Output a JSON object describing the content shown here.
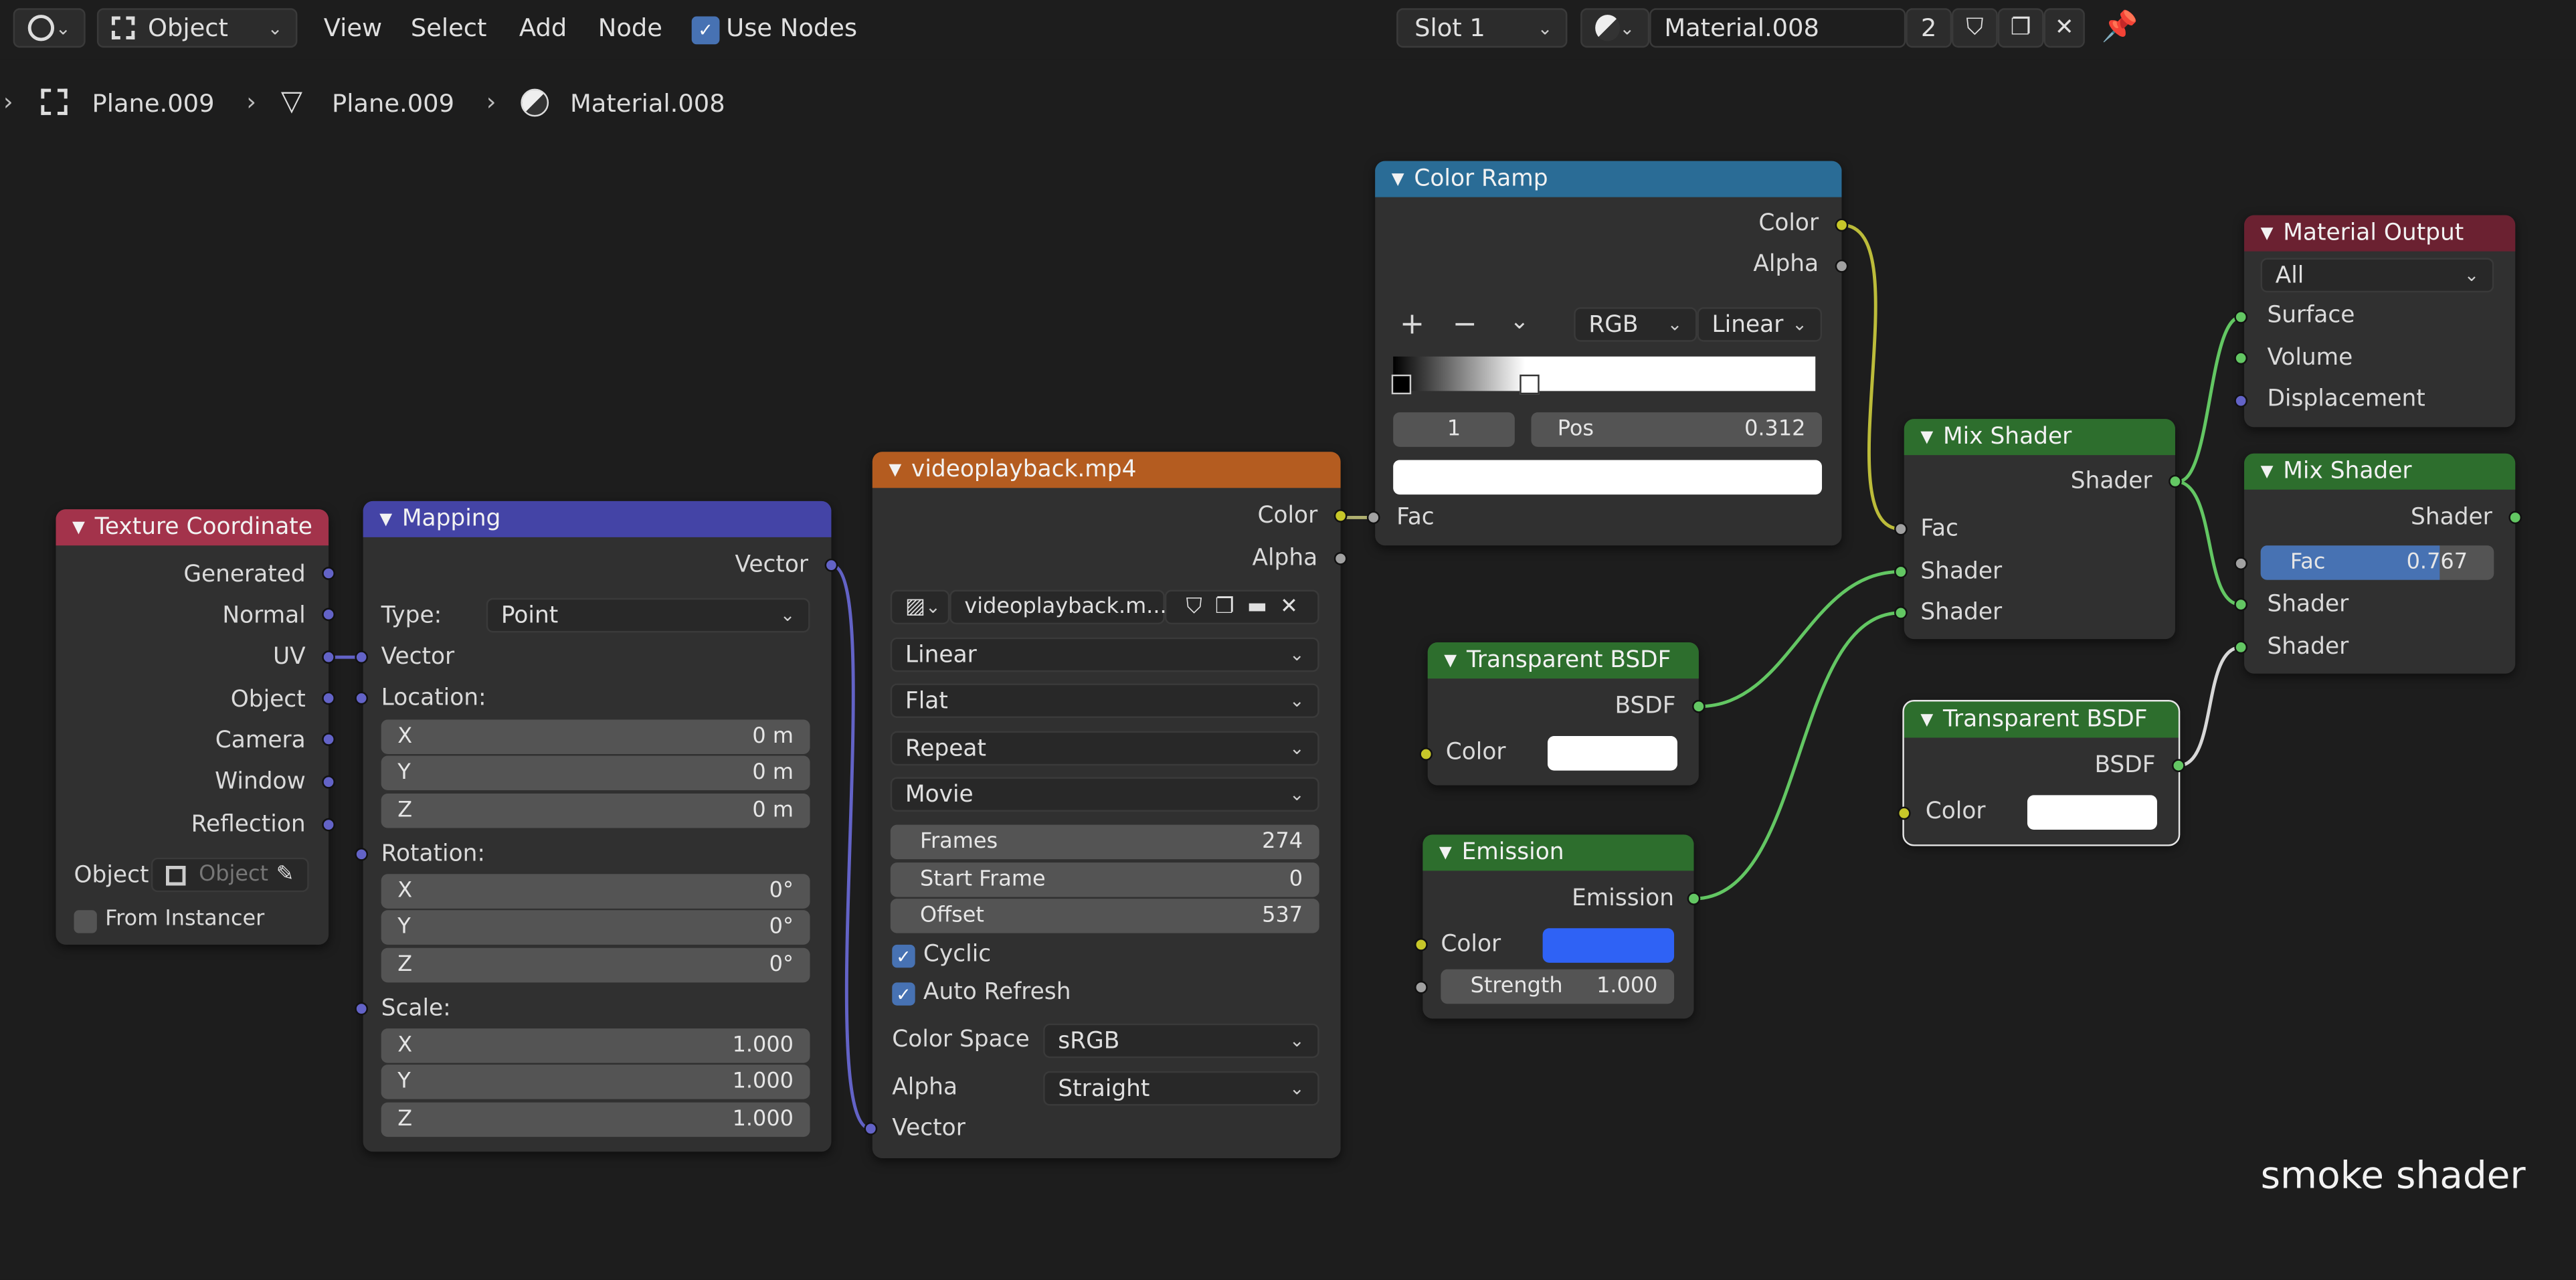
{
  "header": {
    "mode": "Object",
    "menus": [
      "View",
      "Select",
      "Add",
      "Node"
    ],
    "use_nodes_label": "Use Nodes",
    "slot": "Slot 1",
    "material_name": "Material.008",
    "user_count": "2"
  },
  "breadcrumb": {
    "items": [
      "Plane.009",
      "Plane.009",
      "Material.008"
    ]
  },
  "nodes": {
    "texcoord": {
      "title": "Texture Coordinate",
      "outputs": [
        "Generated",
        "Normal",
        "UV",
        "Object",
        "Camera",
        "Window",
        "Reflection"
      ],
      "object_label": "Object:",
      "object_placeholder": "Object",
      "from_instancer": "From Instancer"
    },
    "mapping": {
      "title": "Mapping",
      "output": "Vector",
      "type_label": "Type:",
      "type_value": "Point",
      "vector_label": "Vector",
      "location_label": "Location:",
      "location": [
        {
          "axis": "X",
          "value": "0 m"
        },
        {
          "axis": "Y",
          "value": "0 m"
        },
        {
          "axis": "Z",
          "value": "0 m"
        }
      ],
      "rotation_label": "Rotation:",
      "rotation": [
        {
          "axis": "X",
          "value": "0°"
        },
        {
          "axis": "Y",
          "value": "0°"
        },
        {
          "axis": "Z",
          "value": "0°"
        }
      ],
      "scale_label": "Scale:",
      "scale": [
        {
          "axis": "X",
          "value": "1.000"
        },
        {
          "axis": "Y",
          "value": "1.000"
        },
        {
          "axis": "Z",
          "value": "1.000"
        }
      ]
    },
    "video": {
      "title": "videoplayback.mp4",
      "out_color": "Color",
      "out_alpha": "Alpha",
      "image_name": "videoplayback.m...",
      "interpolation": "Linear",
      "projection": "Flat",
      "extension": "Repeat",
      "source": "Movie",
      "frames_label": "Frames",
      "frames": "274",
      "start_label": "Start Frame",
      "start": "0",
      "offset_label": "Offset",
      "offset": "537",
      "cyclic": "Cyclic",
      "auto_refresh": "Auto Refresh",
      "colorspace_label": "Color Space",
      "colorspace": "sRGB",
      "alpha_label": "Alpha",
      "alpha": "Straight",
      "in_vector": "Vector"
    },
    "colorramp": {
      "title": "Color Ramp",
      "out_color": "Color",
      "out_alpha": "Alpha",
      "mode": "RGB",
      "interp": "Linear",
      "index": "1",
      "pos_label": "Pos",
      "pos": "0.312",
      "in_fac": "Fac"
    },
    "transparent1": {
      "title": "Transparent BSDF",
      "out": "BSDF",
      "in_color": "Color"
    },
    "emission": {
      "title": "Emission",
      "out": "Emission",
      "in_color": "Color",
      "strength_label": "Strength",
      "strength": "1.000",
      "color": "#2f62f5"
    },
    "mix1": {
      "title": "Mix Shader",
      "out": "Shader",
      "in_fac": "Fac",
      "in_shader1": "Shader",
      "in_shader2": "Shader"
    },
    "transparent2": {
      "title": "Transparent BSDF",
      "out": "BSDF",
      "in_color": "Color"
    },
    "output": {
      "title": "Material Output",
      "target": "All",
      "in_surface": "Surface",
      "in_volume": "Volume",
      "in_displacement": "Displacement"
    },
    "mix2": {
      "title": "Mix Shader",
      "out": "Shader",
      "fac_label": "Fac",
      "fac": "0.767",
      "fac_fraction": 0.767,
      "in_shader1": "Shader",
      "in_shader2": "Shader"
    }
  },
  "watermark": "smoke shader",
  "colors": {
    "texcoord_header": "#a3334b",
    "mapping_header": "#4444a6",
    "video_header": "#b45c20",
    "ramp_header": "#2a6c96",
    "shader_header": "#2d6e2d",
    "output_header": "#6b2131",
    "accent": "#4772b3"
  }
}
